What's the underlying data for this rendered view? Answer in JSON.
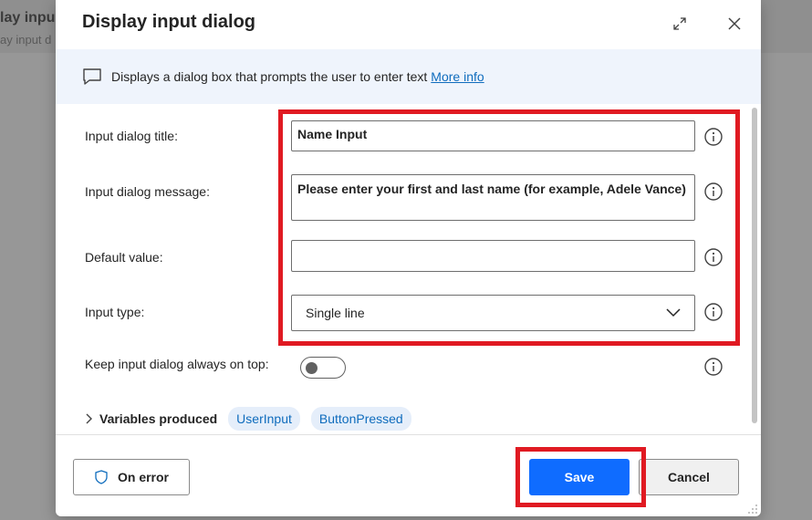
{
  "background": {
    "title": "lay inpu",
    "subtitle": "ay input d"
  },
  "dialog": {
    "title": "Display input dialog",
    "info_text": "Displays a dialog box that prompts the user to enter text",
    "more_info": "More info"
  },
  "form": {
    "title_label": "Input dialog title:",
    "title_value": "Name Input",
    "message_label": "Input dialog message:",
    "message_value": "Please enter your first and last name (for example, Adele Vance)",
    "default_label": "Default value:",
    "default_value": "",
    "type_label": "Input type:",
    "type_value": "Single line",
    "ontop_label": "Keep input dialog always on top:",
    "ontop_enabled": false,
    "vars_label": "Variables produced",
    "vars": [
      "UserInput",
      "ButtonPressed"
    ]
  },
  "footer": {
    "on_error": "On error",
    "save": "Save",
    "cancel": "Cancel"
  },
  "colors": {
    "primary": "#0f6cff",
    "highlight": "#e01a22",
    "link": "#0f6cbd"
  }
}
